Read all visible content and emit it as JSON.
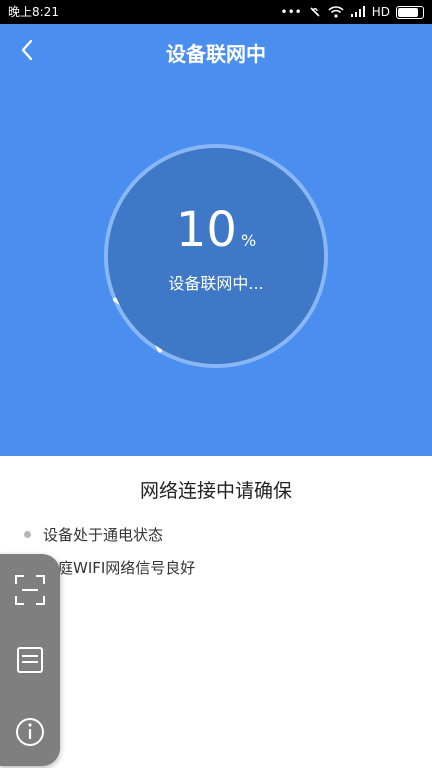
{
  "statusbar": {
    "time": "晚上8:21",
    "network": "HD"
  },
  "header": {
    "title": "设备联网中"
  },
  "progress": {
    "value": "10",
    "unit": "%",
    "status": "设备联网中...",
    "fraction": 0.1
  },
  "info": {
    "heading": "网络连接中请确保",
    "items": [
      "设备处于通电状态",
      "家庭WIFI网络信号良好"
    ]
  },
  "colors": {
    "accent": "#4a8ff0",
    "circle": "#3f78c7",
    "panel": "#7f7f7f"
  },
  "icons": [
    "back-arrow-icon",
    "scan-icon",
    "list-icon",
    "info-icon",
    "signal-icon",
    "wifi-icon",
    "battery-icon"
  ]
}
